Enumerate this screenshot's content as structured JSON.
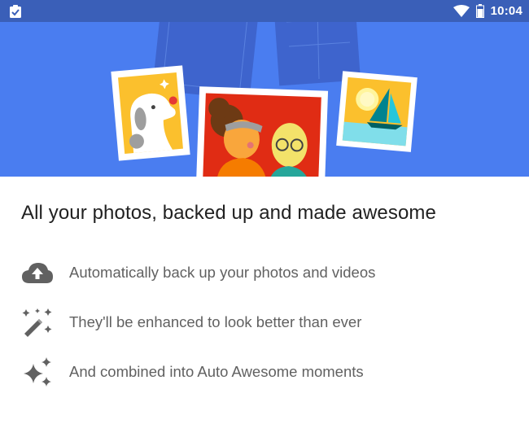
{
  "status_bar": {
    "time": "10:04",
    "left_icon": "clipboard-check-icon",
    "wifi_icon": "wifi-icon",
    "battery_icon": "battery-icon"
  },
  "hero": {
    "background_color": "#4a7df0",
    "illustrations": [
      "dog-photo",
      "people-photo",
      "sailboat-photo"
    ]
  },
  "headline": "All your photos, backed up and made awesome",
  "features": [
    {
      "icon": "cloud-upload-icon",
      "text": "Automatically back up your photos and videos"
    },
    {
      "icon": "magic-wand-icon",
      "text": "They'll be enhanced to look better than ever"
    },
    {
      "icon": "sparkles-icon",
      "text": "And combined into Auto Awesome moments"
    }
  ],
  "colors": {
    "status_bar": "#3a5fb8",
    "hero": "#4a7df0",
    "headline": "#212121",
    "body_text": "#616161",
    "icon": "#616161"
  }
}
